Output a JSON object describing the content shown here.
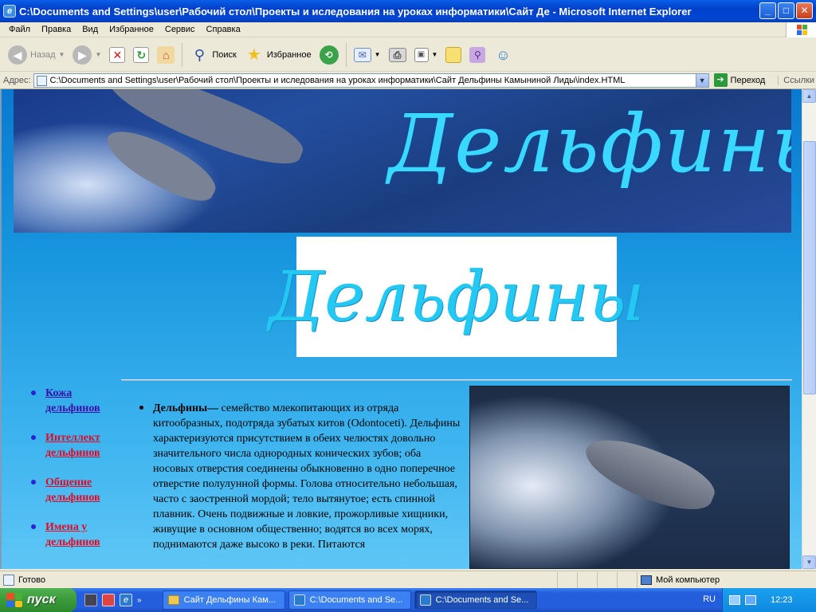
{
  "window": {
    "title": "C:\\Documents and Settings\\user\\Рабочий стол\\Проекты и иследования на уроках информатики\\Сайт Де - Microsoft Internet Explorer",
    "btn_min": "_",
    "btn_max": "□",
    "btn_close": "✕"
  },
  "menu": [
    "Файл",
    "Правка",
    "Вид",
    "Избранное",
    "Сервис",
    "Справка"
  ],
  "toolbar": {
    "back": "Назад",
    "search": "Поиск",
    "favorites": "Избранное"
  },
  "address": {
    "label": "Адрес:",
    "url": "C:\\Documents and Settings\\user\\Рабочий стол\\Проекты и иследования на уроках информатики\\Сайт Дельфины Камыниной Лиды\\index.HTML",
    "go": "Переход",
    "links": "Ссылки"
  },
  "page": {
    "banner_title": "Дельфины",
    "logo_title": "Дельфины",
    "nav": [
      {
        "label": "Кожа дельфинов",
        "color": "#3c0ea6"
      },
      {
        "label": "Интеллект дельфинов",
        "color": "#e10a27"
      },
      {
        "label": "Общение дельфинов",
        "color": "#e10a27"
      },
      {
        "label": "Имена у дельфинов",
        "color": "#e10a27"
      }
    ],
    "article": {
      "term": "Дельфины",
      "dash": "—",
      "text": " семейство млекопитающих из отряда китообразных, подотряда зубатых китов (Odontoceti). Дельфины характеризуются присутствием в обеих челюстях довольно значительного числа однородных конических зубов; оба носовых отверстия соединены обыкновенно в одно поперечное отверстие полулунной формы. Голова относительно небольшая, часто с заостренной мордой; тело вытянутое; есть спинной плавник. Очень подвижные и ловкие, прожорливые хищники, живущие в основном общественно; водятся во всех морях, поднимаются даже высоко в реки. Питаются"
    }
  },
  "status": {
    "text": "Готово",
    "zone": "Мой компьютер"
  },
  "taskbar": {
    "start": "пуск",
    "windows": [
      "Сайт Дельфины Кам...",
      "C:\\Documents and Se...",
      "C:\\Documents and Se..."
    ],
    "lang": "RU",
    "time": "12:23",
    "chevron": "»"
  },
  "colors": {
    "title_blue": "#0046d6",
    "page_bg": "#1896de",
    "link_visited": "#3c0ea6",
    "link_red": "#e10a27",
    "script_cyan": "#23c8f3"
  }
}
